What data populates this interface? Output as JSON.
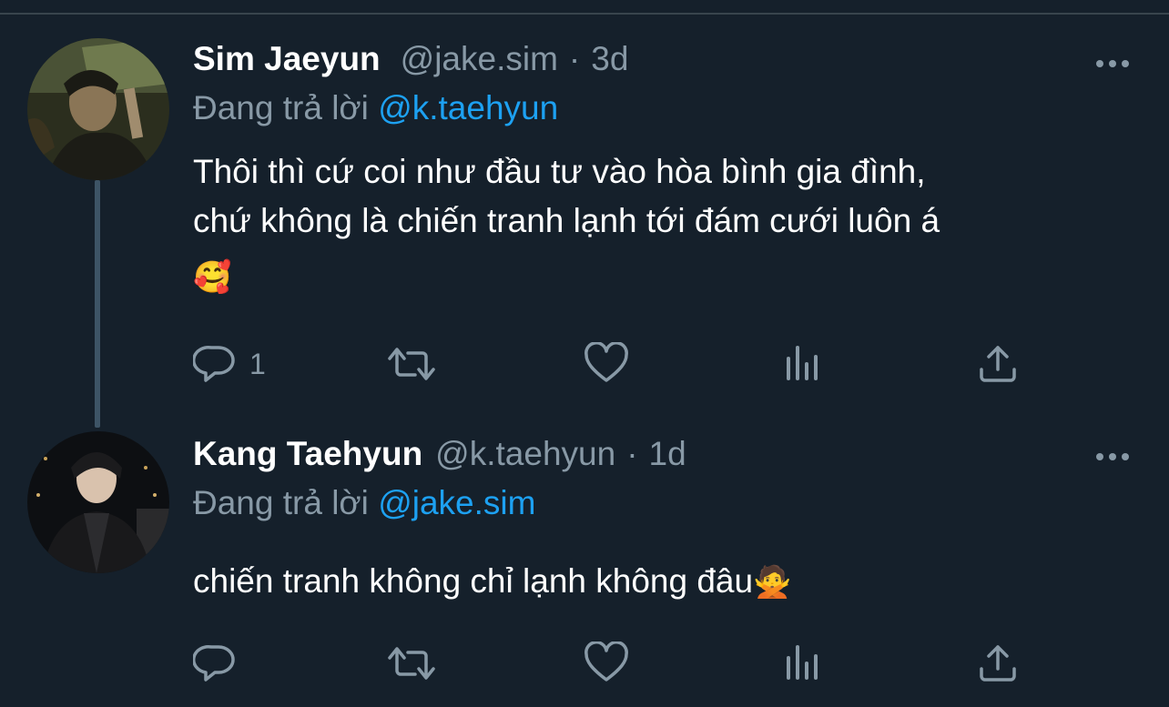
{
  "tweets": [
    {
      "display_name": "Sim Jaeyun",
      "handle": "@jake.sim",
      "separator": "·",
      "time": "3d",
      "replying_prefix": "Đang trả lời",
      "replying_to": "@k.taehyun",
      "text_line1": "Thôi thì cứ coi như đầu tư vào hòa bình gia đình,",
      "text_line2": "chứ không là chiến tranh lạnh tới đám cưới luôn á",
      "emoji": "🥰",
      "reply_count": "1",
      "icons": [
        "reply-icon",
        "retweet-icon",
        "like-icon",
        "analytics-icon",
        "share-icon"
      ]
    },
    {
      "display_name": "Kang Taehyun",
      "handle": "@k.taehyun",
      "separator": "·",
      "time": "1d",
      "replying_prefix": "Đang trả lời",
      "replying_to": "@jake.sim",
      "text_line1": "chiến tranh không chỉ lạnh không đâu",
      "emoji": "🙅",
      "reply_count": "",
      "icons": [
        "reply-icon",
        "retweet-icon",
        "like-icon",
        "analytics-icon",
        "share-icon"
      ]
    }
  ],
  "colors": {
    "background": "#15202b",
    "text": "#ffffff",
    "muted": "#8899a6",
    "link": "#1da1f2",
    "thread_line": "#3d5466"
  }
}
